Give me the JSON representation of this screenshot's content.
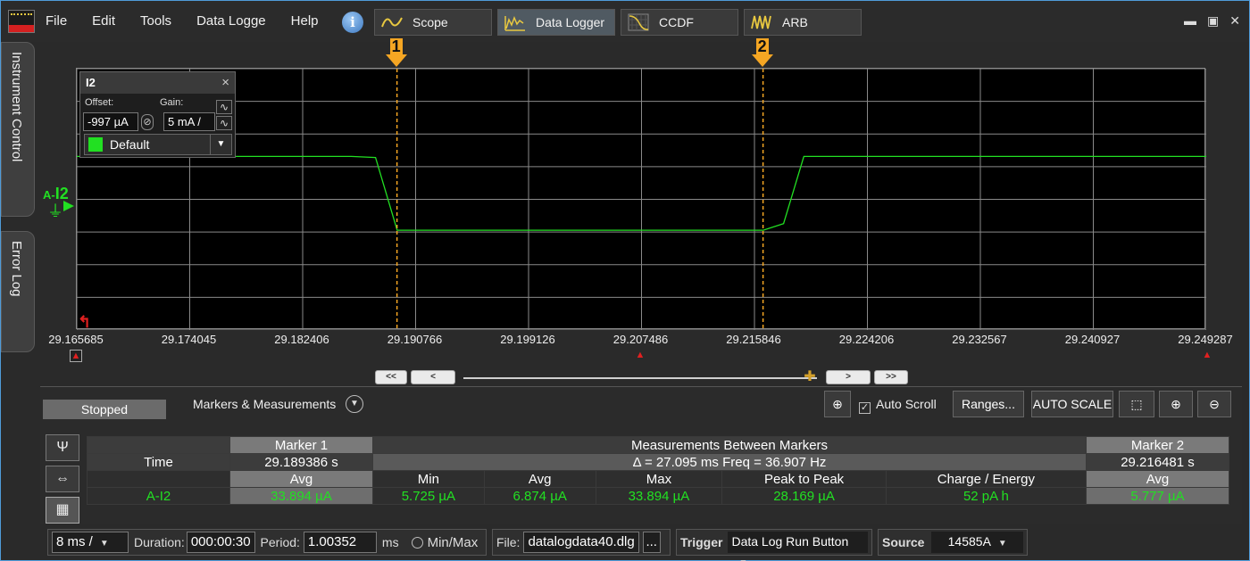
{
  "menu": {
    "items": [
      "File",
      "Edit",
      "Tools",
      "Data Logge",
      "Help"
    ]
  },
  "tabs": [
    {
      "label": "Scope"
    },
    {
      "label": "Data Logger"
    },
    {
      "label": "CCDF"
    },
    {
      "label": "ARB"
    }
  ],
  "side_tabs": {
    "instrument_control": "Instrument Control",
    "error_log": "Error Log"
  },
  "channel_panel": {
    "title": "I2",
    "close": "×",
    "offset_label": "Offset:",
    "offset_value": "-997 µA",
    "gain_label": "Gain:",
    "gain_value": "5 mA /",
    "color_setting": "Default"
  },
  "channel": {
    "prefix": "A-",
    "name": "I2"
  },
  "markers": [
    {
      "label": "1",
      "time": 29.189386
    },
    {
      "label": "2",
      "time": 29.216481
    }
  ],
  "x_axis": {
    "ticks": [
      "29.165685",
      "29.174045",
      "29.182406",
      "29.190766",
      "29.199126",
      "29.207486",
      "29.215846",
      "29.224206",
      "29.232567",
      "29.240927",
      "29.249287"
    ],
    "range": [
      29.165685,
      29.249287
    ]
  },
  "chart_data": {
    "type": "line",
    "series": [
      {
        "name": "A-I2",
        "x": [
          29.165685,
          29.1699,
          29.1745,
          29.18,
          29.186,
          29.1878,
          29.1894,
          29.2,
          29.21,
          29.2165,
          29.218,
          29.2195,
          29.23,
          29.24,
          29.2493
        ],
        "y": [
          33.9,
          33.9,
          33.9,
          33.9,
          33.9,
          33.5,
          5.7,
          5.7,
          5.7,
          5.7,
          8.2,
          33.9,
          33.9,
          33.9,
          33.9
        ]
      }
    ],
    "grid": true
  },
  "status": "Stopped",
  "measurements": {
    "title": "Markers & Measurements",
    "auto_scroll": "Auto Scroll",
    "ranges_btn": "Ranges...",
    "autoscale_btn": "AUTO SCALE",
    "table": {
      "marker1_header": "Marker 1",
      "between_header": "Measurements Between Markers",
      "marker2_header": "Marker 2",
      "time_label": "Time",
      "marker1_time": "29.189386 s",
      "delta": "Δ = 27.095 ms   Freq = 36.907 Hz",
      "marker2_time": "29.216481 s",
      "col_headers": [
        "Avg",
        "Min",
        "Avg",
        "Max",
        "Peak to Peak",
        "Charge / Energy",
        "Avg"
      ],
      "channel": "A-I2",
      "values": [
        "33.894 µA",
        "5.725 µA",
        "6.874 µA",
        "33.894 µA",
        "28.169 µA",
        "52 pA h",
        "5.777 µA"
      ]
    }
  },
  "footer": {
    "timebase": "8 ms /",
    "duration_label": "Duration:",
    "duration_value": "000:00:30",
    "period_label": "Period:",
    "period_value": "1.00352",
    "period_unit": "ms",
    "minmax": "Min/Max",
    "file_label": "File:",
    "file_value": "datalogdata40.dlg",
    "file_browse": "...",
    "trigger_label": "Trigger",
    "trigger_value": "Data Log Run Button",
    "source_label": "Source",
    "source_value": "14585A"
  },
  "colors": {
    "trace": "#22e022",
    "marker": "#f5a623",
    "grid": "#8a8a8a"
  }
}
